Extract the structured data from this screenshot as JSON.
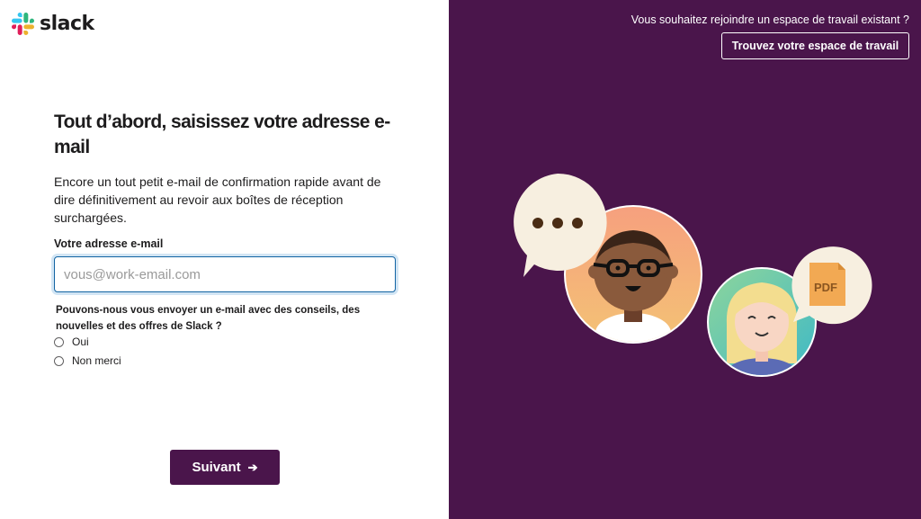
{
  "brand": {
    "name": "slack"
  },
  "form": {
    "title": "Tout d’abord, saisissez votre adresse e-mail",
    "description": "Encore un tout petit e-mail de confirmation rapide avant de dire définitivement au revoir aux boîtes de réception surchargées.",
    "email_label": "Votre adresse e-mail",
    "email_placeholder": "vous@work-email.com",
    "email_value": "",
    "newsletter_question": "Pouvons-nous vous envoyer un e-mail avec des conseils, des nouvelles et des offres de Slack ?",
    "options": [
      "Oui",
      "Non merci"
    ],
    "next_label": "Suivant",
    "next_icon": "arrow-right-icon"
  },
  "side": {
    "join_prompt": "Vous souhaitez rejoindre un espace de travail existant ?",
    "find_button": "Trouvez votre espace de travail",
    "illustration": {
      "file_badge": "PDF"
    }
  },
  "colors": {
    "aubergine": "#4a154b",
    "focus": "#1264a3"
  }
}
